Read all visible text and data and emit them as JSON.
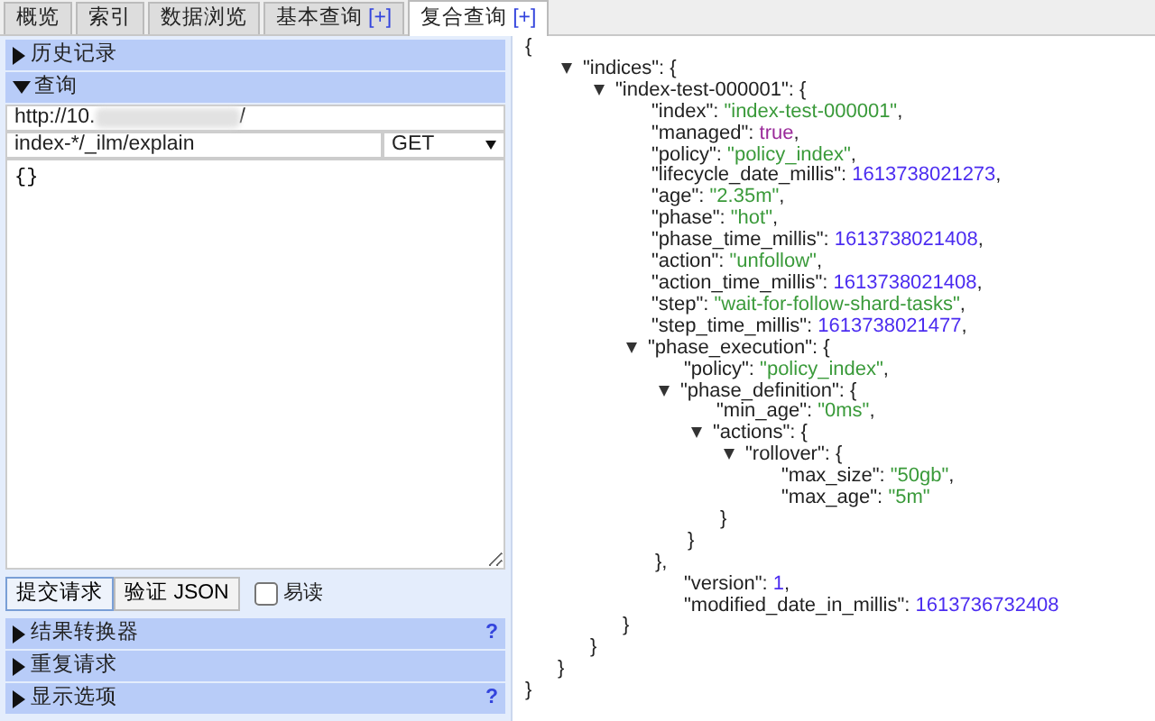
{
  "tabs": [
    {
      "label": "概览",
      "selected": false
    },
    {
      "label": "索引",
      "selected": false
    },
    {
      "label": "数据浏览",
      "selected": false
    },
    {
      "label": "基本查询",
      "badge": "[+]",
      "selected": false
    },
    {
      "label": "复合查询",
      "badge": "[+]",
      "selected": true
    }
  ],
  "left_panel": {
    "sections_top": [
      {
        "label": "历史记录",
        "expanded": false
      },
      {
        "label": "查询",
        "expanded": true
      }
    ],
    "query": {
      "url_start": "http://10.",
      "url_end": "/",
      "path": "index-*/_ilm/explain",
      "method": "GET",
      "body": "{}"
    },
    "buttons": [
      {
        "label": "提交请求",
        "focused": true
      },
      {
        "label": "验证 JSON",
        "focused": false
      }
    ],
    "readable": {
      "label": "易读",
      "checked": false
    },
    "sections_bottom": [
      {
        "label": "结果转换器",
        "expanded": false,
        "help": "?"
      },
      {
        "label": "重复请求",
        "expanded": false
      },
      {
        "label": "显示选项",
        "expanded": false,
        "help": "?"
      }
    ]
  },
  "result": {
    "open": "{",
    "close": "}",
    "children": [
      {
        "label": "\"indices\": {",
        "expanded": true,
        "close": "}",
        "children": [
          {
            "label": "\"index-test-000001\": {",
            "expanded": true,
            "close": "}",
            "children": [
              {
                "key": "\"index\": ",
                "value": "\"index-test-000001\"",
                "kind": "string",
                "trail": ","
              },
              {
                "key": "\"managed\": ",
                "value": "true",
                "kind": "boolean",
                "trail": ","
              },
              {
                "key": "\"policy\": ",
                "value": "\"policy_index\"",
                "kind": "string",
                "trail": ","
              },
              {
                "key": "\"lifecycle_date_millis\": ",
                "value": "1613738021273",
                "kind": "number",
                "trail": ","
              },
              {
                "key": "\"age\": ",
                "value": "\"2.35m\"",
                "kind": "string",
                "trail": ","
              },
              {
                "key": "\"phase\": ",
                "value": "\"hot\"",
                "kind": "string",
                "trail": ","
              },
              {
                "key": "\"phase_time_millis\": ",
                "value": "1613738021408",
                "kind": "number",
                "trail": ","
              },
              {
                "key": "\"action\": ",
                "value": "\"unfollow\"",
                "kind": "string",
                "trail": ","
              },
              {
                "key": "\"action_time_millis\": ",
                "value": "1613738021408",
                "kind": "number",
                "trail": ","
              },
              {
                "key": "\"step\": ",
                "value": "\"wait-for-follow-shard-tasks\"",
                "kind": "string",
                "trail": ","
              },
              {
                "key": "\"step_time_millis\": ",
                "value": "1613738021477",
                "kind": "number",
                "trail": ","
              },
              {
                "label": "\"phase_execution\": {",
                "expanded": true,
                "close": "}",
                "children": [
                  {
                    "key": "\"policy\": ",
                    "value": "\"policy_index\"",
                    "kind": "string",
                    "trail": ","
                  },
                  {
                    "label": "\"phase_definition\": {",
                    "expanded": true,
                    "close": "},",
                    "children": [
                      {
                        "key": "\"min_age\": ",
                        "value": "\"0ms\"",
                        "kind": "string",
                        "trail": ","
                      },
                      {
                        "label": "\"actions\": {",
                        "expanded": true,
                        "close": "}",
                        "children": [
                          {
                            "label": "\"rollover\": {",
                            "expanded": true,
                            "close": "}",
                            "children": [
                              {
                                "key": "\"max_size\": ",
                                "value": "\"50gb\"",
                                "kind": "string",
                                "trail": ","
                              },
                              {
                                "key": "\"max_age\": ",
                                "value": "\"5m\"",
                                "kind": "string"
                              }
                            ]
                          }
                        ]
                      }
                    ]
                  },
                  {
                    "key": "\"version\": ",
                    "value": "1",
                    "kind": "number",
                    "trail": ","
                  },
                  {
                    "key": "\"modified_date_in_millis\": ",
                    "value": "1613736732408",
                    "kind": "number"
                  }
                ]
              }
            ]
          }
        ]
      }
    ]
  }
}
